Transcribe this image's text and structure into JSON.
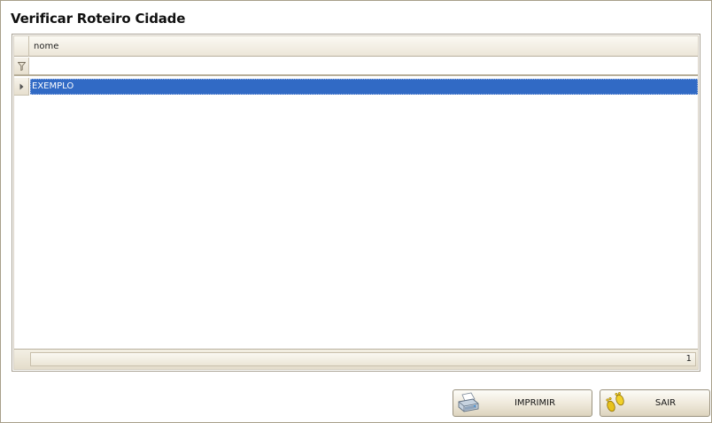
{
  "window": {
    "title": "Verificar Roteiro Cidade"
  },
  "grid": {
    "columns": [
      {
        "header": "nome"
      }
    ],
    "filter": {
      "value": "",
      "placeholder": ""
    },
    "rows": [
      {
        "nome": "EXEMPLO",
        "selected": true
      }
    ],
    "footer": {
      "count": "1"
    }
  },
  "buttons": {
    "print_label": "IMPRIMIR",
    "print_icon": "printer-icon",
    "exit_label": "SAIR",
    "exit_icon": "footprints-icon"
  },
  "colors": {
    "selection": "#316ac5",
    "header_bg": "#ece6d8"
  }
}
